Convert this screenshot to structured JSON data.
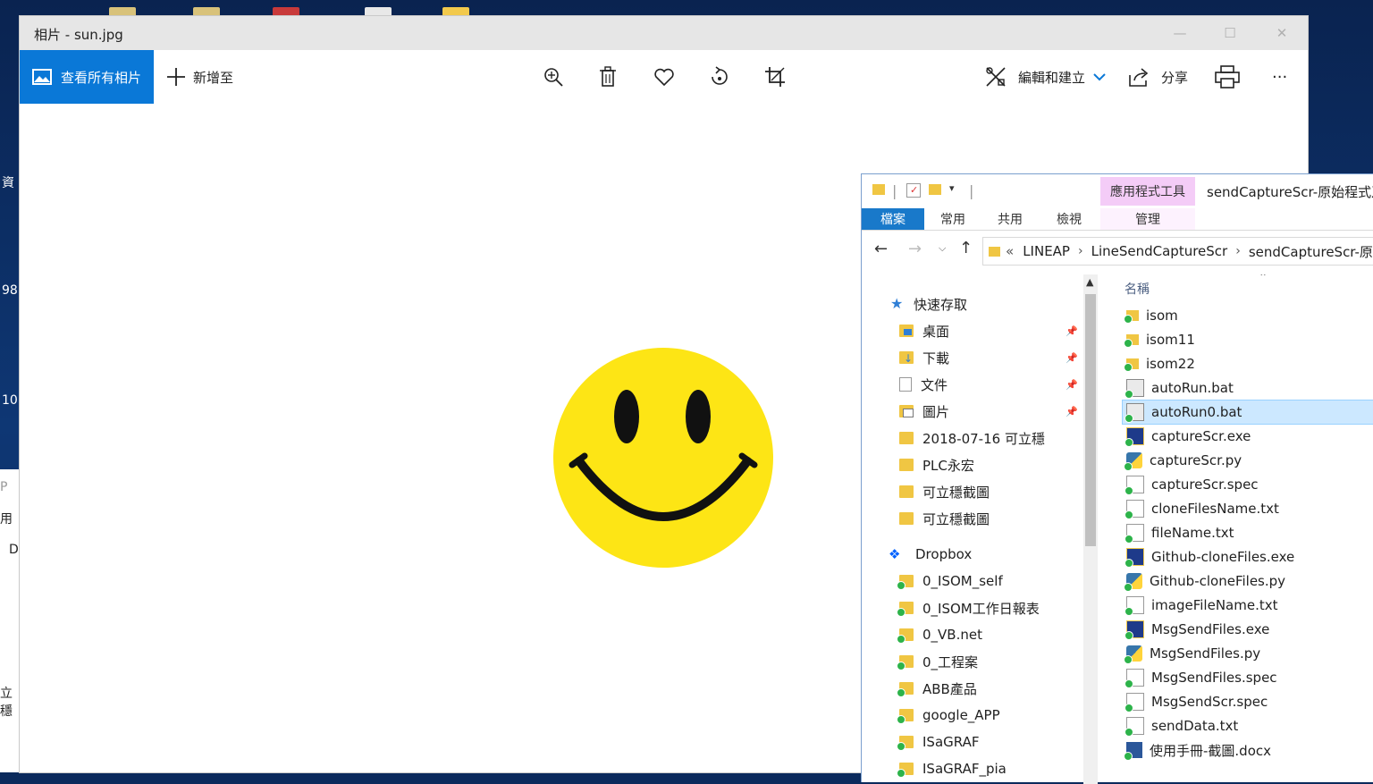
{
  "desktop": {
    "fragments": [
      "資",
      "98",
      "10"
    ],
    "left_window_fragments": [
      "P",
      "用",
      "D",
      "立穩"
    ]
  },
  "photos": {
    "title": "相片 - sun.jpg",
    "view_all_label": "查看所有相片",
    "add_to_label": "新增至",
    "edit_label": "編輯和建立",
    "share_label": "分享",
    "more_label": "···",
    "image_name": "sun.jpg"
  },
  "explorer": {
    "app_tools_label": "應用程式工具",
    "window_title": "sendCaptureScr-原始程式及",
    "ribbon_tabs": [
      "檔案",
      "常用",
      "共用",
      "檢視",
      "管理"
    ],
    "breadcrumb": [
      "LINEAP",
      "LineSendCaptureScr",
      "sendCaptureScr-原始"
    ],
    "breadcrumb_prefix": "«",
    "column_header": "名稱",
    "nav_items": [
      {
        "label": "快速存取",
        "icon": "star-icon"
      },
      {
        "label": "桌面",
        "icon": "desktop-folder-icon",
        "pinned": true
      },
      {
        "label": "下載",
        "icon": "download-folder-icon",
        "pinned": true
      },
      {
        "label": "文件",
        "icon": "documents-folder-icon",
        "pinned": true
      },
      {
        "label": "圖片",
        "icon": "pictures-folder-icon",
        "pinned": true
      },
      {
        "label": "2018-07-16 可立穩",
        "icon": "folder-icon"
      },
      {
        "label": "PLC永宏",
        "icon": "folder-icon"
      },
      {
        "label": "可立穩截圖",
        "icon": "folder-icon"
      },
      {
        "label": "可立穩截圖",
        "icon": "folder-icon"
      },
      {
        "label": "Dropbox",
        "icon": "dropbox-icon"
      },
      {
        "label": "0_ISOM_self",
        "icon": "folder-icon"
      },
      {
        "label": "0_ISOM工作日報表",
        "icon": "folder-icon"
      },
      {
        "label": "0_VB.net",
        "icon": "folder-icon"
      },
      {
        "label": "0_工程案",
        "icon": "folder-icon"
      },
      {
        "label": "ABB產品",
        "icon": "folder-icon"
      },
      {
        "label": "google_APP",
        "icon": "folder-icon"
      },
      {
        "label": "ISaGRAF",
        "icon": "folder-icon"
      },
      {
        "label": "ISaGRAF_pia",
        "icon": "folder-icon"
      }
    ],
    "files": [
      {
        "name": "isom",
        "type": "folder"
      },
      {
        "name": "isom11",
        "type": "folder"
      },
      {
        "name": "isom22",
        "type": "folder"
      },
      {
        "name": "autoRun.bat",
        "type": "bat"
      },
      {
        "name": "autoRun0.bat",
        "type": "bat",
        "selected": true
      },
      {
        "name": "captureScr.exe",
        "type": "exe"
      },
      {
        "name": "captureScr.py",
        "type": "py"
      },
      {
        "name": "captureScr.spec",
        "type": "txt"
      },
      {
        "name": "cloneFilesName.txt",
        "type": "txt"
      },
      {
        "name": "fileName.txt",
        "type": "txt"
      },
      {
        "name": "Github-cloneFiles.exe",
        "type": "exe"
      },
      {
        "name": "Github-cloneFiles.py",
        "type": "py"
      },
      {
        "name": "imageFileName.txt",
        "type": "txt"
      },
      {
        "name": "MsgSendFiles.exe",
        "type": "exe"
      },
      {
        "name": "MsgSendFiles.py",
        "type": "py"
      },
      {
        "name": "MsgSendFiles.spec",
        "type": "txt"
      },
      {
        "name": "MsgSendScr.spec",
        "type": "txt"
      },
      {
        "name": "sendData.txt",
        "type": "txt"
      },
      {
        "name": "使用手冊-截圖.docx",
        "type": "docx"
      }
    ]
  },
  "colors": {
    "accent": "#0a78d7",
    "smiley_face": "#fde515",
    "selection": "#cce8ff"
  }
}
